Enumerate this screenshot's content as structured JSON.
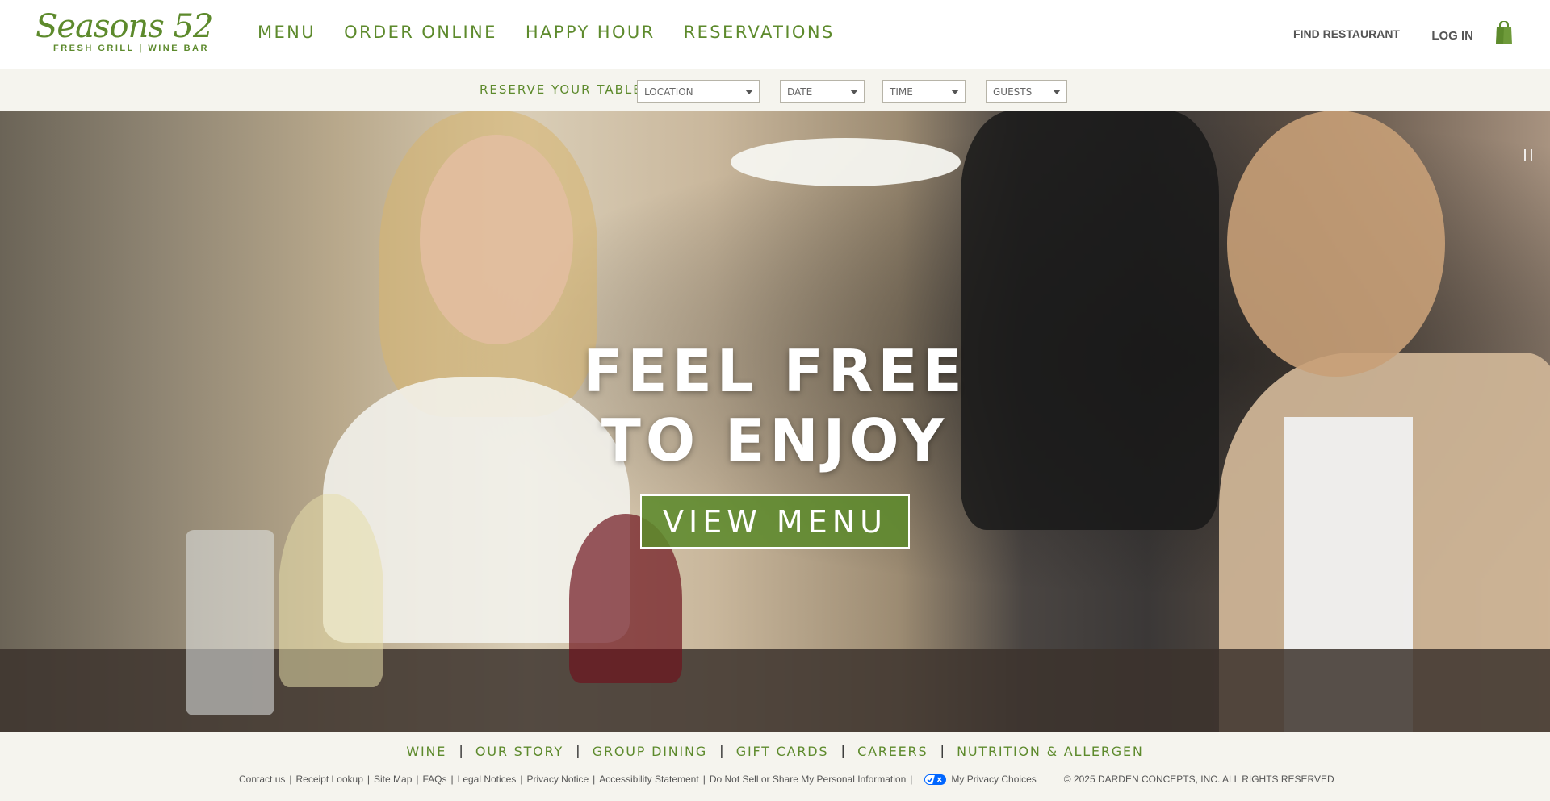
{
  "header": {
    "logo": {
      "script": "Seasons 52",
      "tagline": "FRESH GRILL | WINE BAR"
    },
    "nav": [
      {
        "label": "MENU"
      },
      {
        "label": "ORDER ONLINE"
      },
      {
        "label": "HAPPY HOUR"
      },
      {
        "label": "RESERVATIONS"
      }
    ],
    "find_restaurant": "FIND RESTAURANT",
    "login": "LOG IN",
    "bag_icon": "shopping-bag-icon"
  },
  "reserve": {
    "label": "RESERVE YOUR TABLE",
    "location": "LOCATION",
    "date": "DATE",
    "time": "TIME",
    "guests": "GUESTS"
  },
  "hero": {
    "line1": "FEEL FREE",
    "line2": "TO ENJOY",
    "cta": "VIEW MENU",
    "pause_icon": "pause-icon"
  },
  "footer": {
    "nav": [
      {
        "label": "WINE"
      },
      {
        "label": "OUR STORY"
      },
      {
        "label": "GROUP DINING"
      },
      {
        "label": "GIFT CARDS"
      },
      {
        "label": "CAREERS"
      },
      {
        "label": "NUTRITION & ALLERGEN"
      }
    ],
    "links": [
      {
        "label": "Contact us"
      },
      {
        "label": "Receipt Lookup"
      },
      {
        "label": "Site Map"
      },
      {
        "label": "FAQs"
      },
      {
        "label": "Legal Notices"
      },
      {
        "label": "Privacy Notice"
      },
      {
        "label": "Accessibility Statement"
      },
      {
        "label": "Do Not Sell or Share My Personal Information"
      }
    ],
    "privacy_choices": "My Privacy Choices",
    "copyright": "© 2025 DARDEN CONCEPTS, INC. ALL RIGHTS RESERVED"
  },
  "colors": {
    "brand_green": "#5d8a2c",
    "bar_bg": "#f5f4ee",
    "text_gray": "#555555"
  }
}
